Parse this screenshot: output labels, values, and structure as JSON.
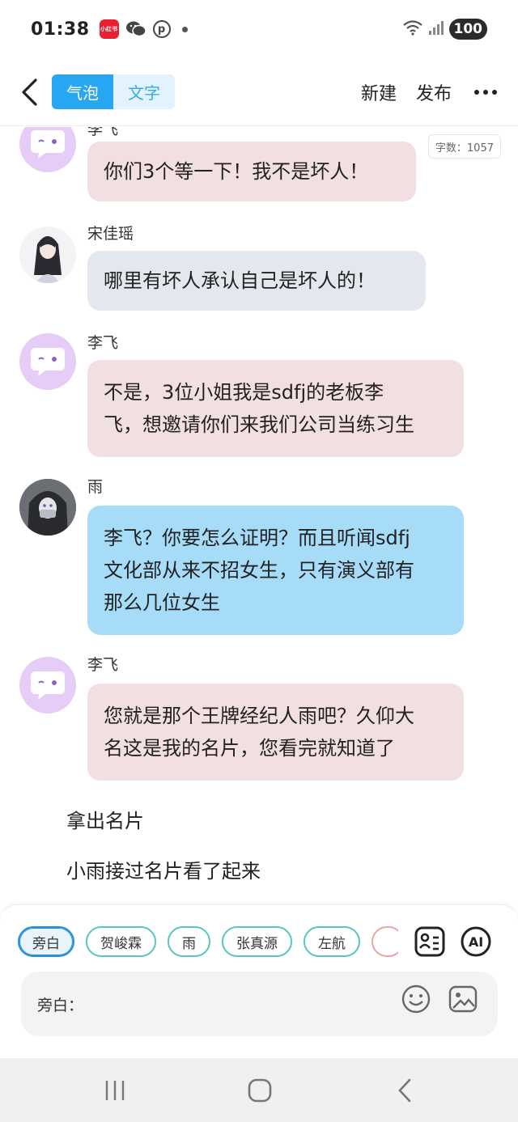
{
  "status": {
    "time": "01:38",
    "app_badge": "小红书",
    "battery": "100"
  },
  "header": {
    "tabs": [
      {
        "label": "气泡"
      },
      {
        "label": "文字"
      }
    ],
    "new_label": "新建",
    "publish_label": "发布"
  },
  "word_count": "字数：1057",
  "messages": [
    {
      "speaker": "李飞",
      "text": "你们3个等一下！我不是坏人！"
    },
    {
      "speaker": "宋佳瑶",
      "text": "哪里有坏人承认自己是坏人的！"
    },
    {
      "speaker": "李飞",
      "lines": [
        "不是，3位小姐我是sdfj的老板李",
        "飞，想邀请你们来我们公司当练习生"
      ]
    },
    {
      "speaker": "雨",
      "lines": [
        "李飞？你要怎么证明？而且听闻sdfj",
        "文化部从来不招女生，只有演义部有",
        "那么几位女生"
      ]
    },
    {
      "speaker": "李飞",
      "lines": [
        "您就是那个王牌经纪人雨吧？久仰大",
        "名这是我的名片，您看完就知道了"
      ]
    }
  ],
  "narrations": [
    "拿出名片",
    "小雨接过名片看了起来"
  ],
  "characters": [
    {
      "label": "旁白",
      "selected": true
    },
    {
      "label": "贺峻霖"
    },
    {
      "label": "雨"
    },
    {
      "label": "张真源"
    },
    {
      "label": "左航"
    }
  ],
  "tools": {
    "ai_label": "AI"
  },
  "input": {
    "label": "旁白："
  },
  "colors": {
    "accent": "#27a6f2",
    "bubble_pink": "#f2dfe1",
    "bubble_grey": "#e3e7ee",
    "bubble_blue": "#a6dcf8",
    "chip_border": "#56c7be"
  }
}
